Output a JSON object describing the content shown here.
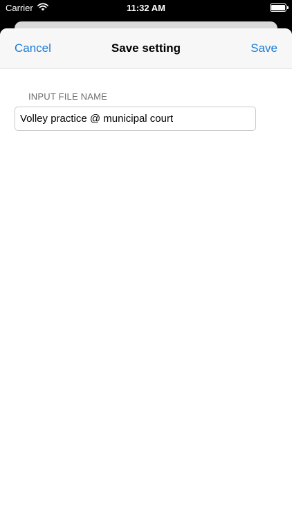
{
  "status_bar": {
    "carrier": "Carrier",
    "time": "11:32 AM"
  },
  "nav": {
    "cancel_label": "Cancel",
    "title": "Save setting",
    "save_label": "Save"
  },
  "form": {
    "file_name_label": "INPUT FILE NAME",
    "file_name_value": "Volley practice @ municipal court"
  },
  "colors": {
    "accent": "#1a7cd6",
    "label": "#6d6d72"
  }
}
